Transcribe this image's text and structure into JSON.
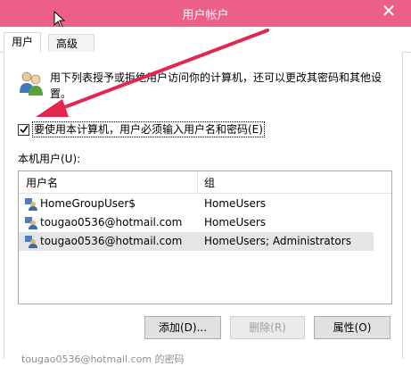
{
  "window": {
    "title": "用户帐户",
    "close_glyph": "✕"
  },
  "tabs": [
    {
      "label": "用户"
    },
    {
      "label": "高级"
    }
  ],
  "description": "用下列表授予或拒绝用户访问你的计算机，还可以更改其密码和其他设置。",
  "checkbox": {
    "label": "要使用本计算机，用户必须输入用户名和密码(E)",
    "checked": true
  },
  "users_section_label": "本机用户(U):",
  "table": {
    "columns": [
      "用户名",
      "组"
    ],
    "rows": [
      {
        "name": "HomeGroupUser$",
        "group": "HomeUsers"
      },
      {
        "name": "tougao0536@hotmail.com",
        "group": "HomeUsers"
      },
      {
        "name": "tougao0536@hotmail.com",
        "group": "HomeUsers; Administrators",
        "selected": true
      }
    ]
  },
  "buttons": {
    "add": "添加(D)...",
    "remove": "删除(R)",
    "properties": "属性(O)"
  },
  "footer_partial": "tougao0536@hotmail.com 的密码",
  "colors": {
    "titlebar": "#ec5f88",
    "arrow": "#e3264e"
  }
}
